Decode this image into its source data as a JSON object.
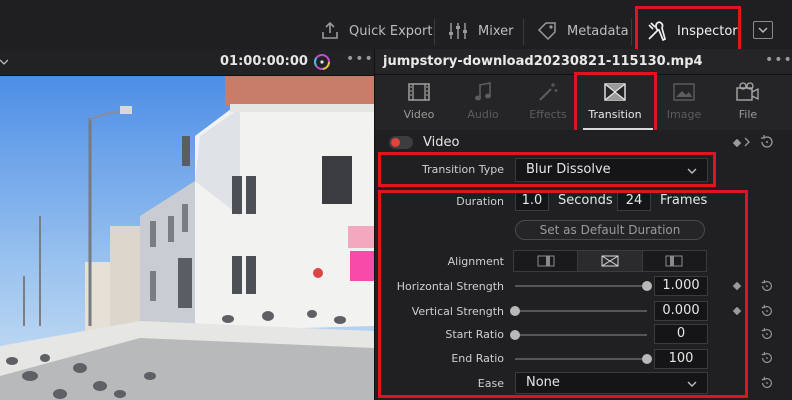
{
  "toolbar": {
    "quick_export": "Quick Export",
    "mixer": "Mixer",
    "metadata": "Metadata",
    "inspector": "Inspector"
  },
  "viewer": {
    "timecode": "01:00:00:00"
  },
  "inspector": {
    "clip_name": "jumpstory-download20230821-115130.mp4",
    "tabs": [
      {
        "label": "Video",
        "icon": "film-icon",
        "state": "normal"
      },
      {
        "label": "Audio",
        "icon": "music-note-icon",
        "state": "disabled"
      },
      {
        "label": "Effects",
        "icon": "magic-wand-icon",
        "state": "disabled"
      },
      {
        "label": "Transition",
        "icon": "transition-icon",
        "state": "active"
      },
      {
        "label": "Image",
        "icon": "image-icon",
        "state": "disabled"
      },
      {
        "label": "File",
        "icon": "file-reel-icon",
        "state": "normal"
      }
    ],
    "section_label": "Video",
    "transition_type_label": "Transition Type",
    "transition_type_value": "Blur Dissolve",
    "duration_label": "Duration",
    "duration_seconds": "1.0",
    "seconds_label": "Seconds",
    "duration_frames": "24",
    "frames_label": "Frames",
    "default_duration_button": "Set as Default Duration",
    "alignment_label": "Alignment",
    "horizontal_strength_label": "Horizontal Strength",
    "horizontal_strength_value": "1.000",
    "horizontal_strength_level": 1.0,
    "vertical_strength_label": "Vertical Strength",
    "vertical_strength_value": "0.000",
    "vertical_strength_level": 0.0,
    "start_ratio_label": "Start Ratio",
    "start_ratio_value": "0",
    "start_ratio_level": 0.0,
    "end_ratio_label": "End Ratio",
    "end_ratio_value": "100",
    "end_ratio_level": 1.0,
    "ease_label": "Ease",
    "ease_value": "None"
  },
  "colors": {
    "highlight_box": "#e1141c",
    "toggle_on": "#e2443a"
  }
}
